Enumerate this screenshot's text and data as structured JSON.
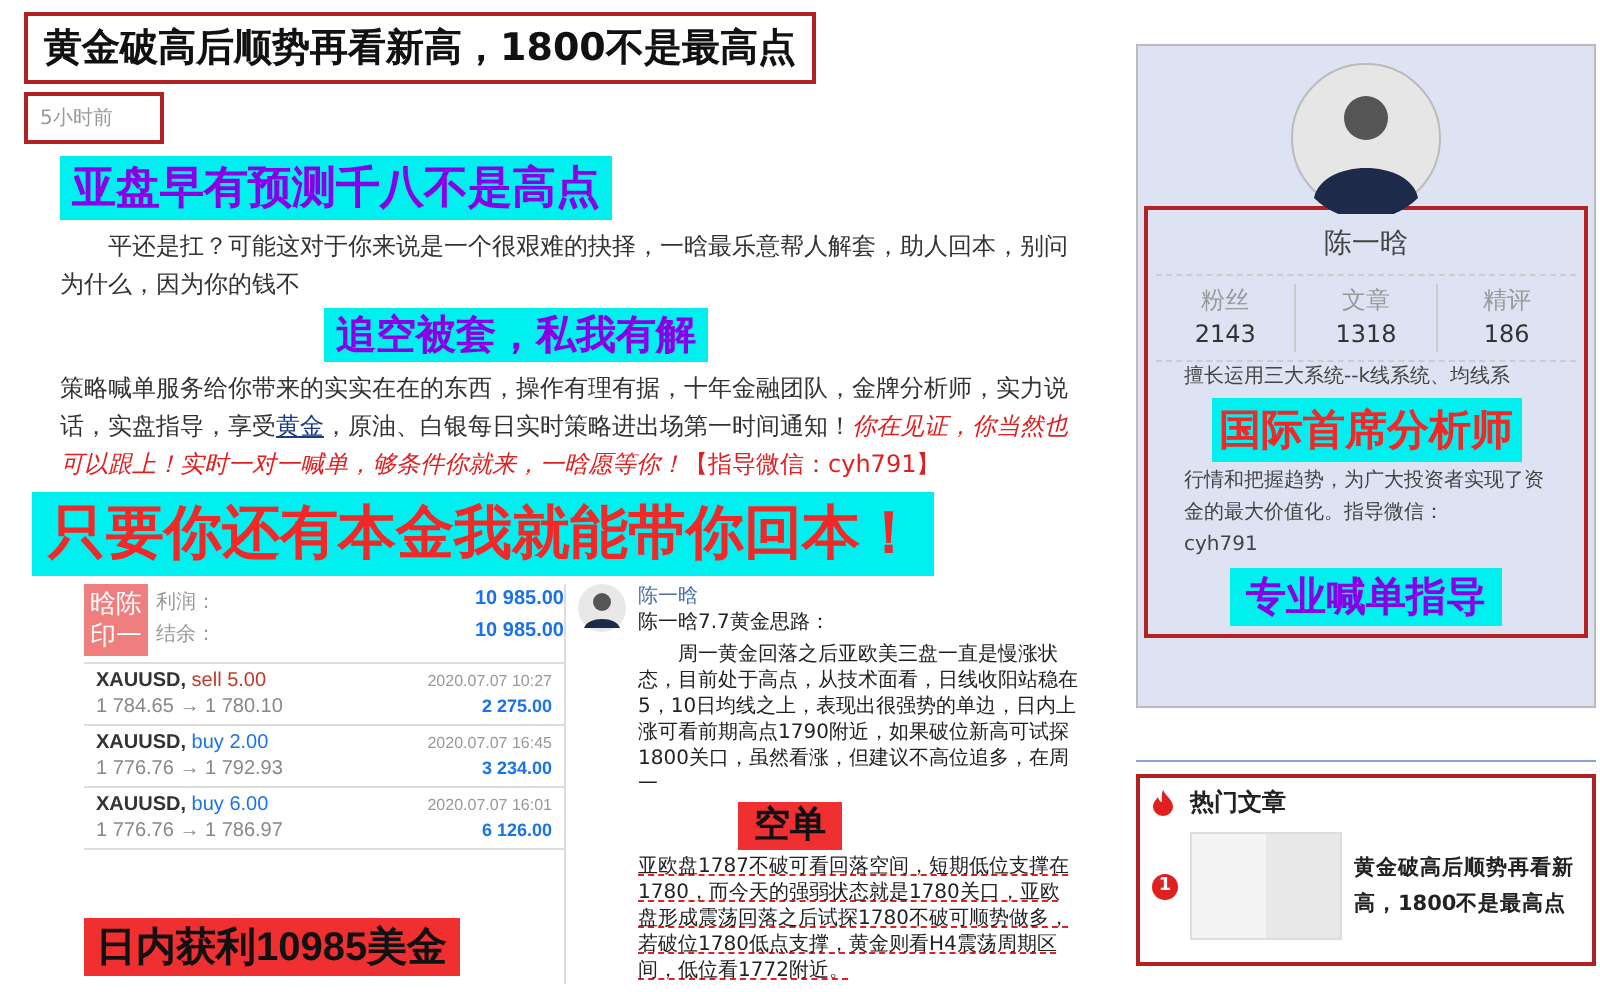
{
  "article": {
    "title": "黄金破高后顺势再看新高，1800不是最高点",
    "time": "5小时前",
    "banner_top": "亚盘早有预测千八不是高点",
    "paragraph_1": "平还是扛？可能这对于你来说是一个很艰难的抉择，一晗最乐意帮人解套，助人回本，别问为什么，因为你的钱不",
    "banner_middle": "追空被套，私我有解",
    "paragraph_2": "策略喊单服务给你带来的实实在在的东西，操作有理有据，十年金融团队，金牌分析师，实力说话，实盘指导，享受",
    "link": "黄金",
    "paragraph_3": "，原油、白银每日实时策略进出场第一时间通知！",
    "highlight": "你在见证，你当然也可以跟上！实时一对一喊单，够条件你就来，一晗愿等你！",
    "contact": "【指导微信：cyh791】",
    "banner_big": "只要你还有本金我就能带你回本！"
  },
  "trade_panel": {
    "stamp": [
      "晗陈",
      "印一"
    ],
    "summary": [
      {
        "label": "利润：",
        "value": "10 985.00"
      },
      {
        "label": "结余：",
        "value": "10 985.00"
      }
    ],
    "trades": [
      {
        "symbol": "XAUUSD,",
        "kind": "sell",
        "lots": "sell 5.00",
        "prices": "1 784.65 → 1 780.10",
        "time": "2020.07.07 10:27",
        "profit": "2 275.00"
      },
      {
        "symbol": "XAUUSD,",
        "kind": "buy",
        "lots": "buy 2.00",
        "prices": "1 776.76 → 1 792.93",
        "time": "2020.07.07 16:45",
        "profit": "3 234.00"
      },
      {
        "symbol": "XAUUSD,",
        "kind": "buy",
        "lots": "buy 6.00",
        "prices": "1 776.76 → 1 786.97",
        "time": "2020.07.07 16:01",
        "profit": "6 126.00"
      }
    ],
    "profit_banner": "日内获利10985美金"
  },
  "post": {
    "author": "陈一晗",
    "subtitle": "陈一晗7.7黄金思路：",
    "text_1": "周一黄金回落之后亚欧美三盘一直是慢涨状态，目前处于高点，从技术面看，日线收阳站稳在5，10日均线之上，表现出很强势的单边，日内上涨可看前期高点1790附近，如果破位新高可试探1800关口，虽然看涨，但建议不高位追多，在周一",
    "tag": "空单",
    "text_2": "亚欧盘1787不破可看回落空间，短期低位支撑在1780，而今天的强弱状态就是1780关口，亚欧盘形成震荡回落之后试探1780不破可顺势做多，若破位1780低点支撑，黄金则看H4震荡周期区间，低位看1772附近。"
  },
  "profile": {
    "name": "陈一晗",
    "stats": [
      {
        "label": "粉丝",
        "value": "2143"
      },
      {
        "label": "文章",
        "value": "1318"
      },
      {
        "label": "精评",
        "value": "186"
      }
    ],
    "bio_1": "擅长运用三大系统--k线系统、均线系",
    "banner_1": "国际首席分析师",
    "bio_2": "行情和把握趋势，为广大投资者实现了资金的最大价值化。指导微信：",
    "bio_3": "cyh791",
    "banner_2": "专业喊单指导"
  },
  "hot_articles": {
    "title": "热门文章",
    "items": [
      {
        "rank": "1",
        "title": "黄金破高后顺势再看新高，1800不是最高点"
      }
    ]
  }
}
